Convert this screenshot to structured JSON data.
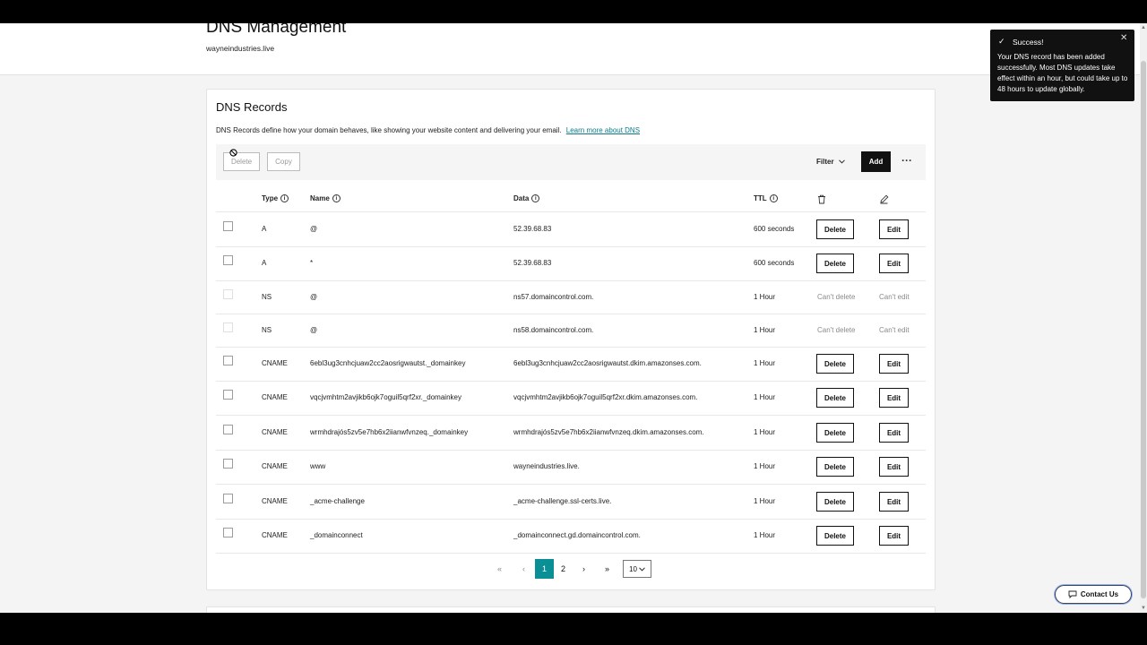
{
  "header": {
    "title": "DNS Management",
    "domain": "wayneindustries.live"
  },
  "records_card": {
    "title": "DNS Records",
    "description": "DNS Records define how your domain behaves, like showing your website content and delivering your email.",
    "learn_more": "Learn more about DNS"
  },
  "toolbar": {
    "delete_label": "Delete",
    "copy_label": "Copy",
    "filter_label": "Filter",
    "add_label": "Add",
    "more_label": "···"
  },
  "columns": {
    "type": "Type",
    "name": "Name",
    "data": "Data",
    "ttl": "TTL"
  },
  "rows": [
    {
      "type": "A",
      "name": "@",
      "data": "52.39.68.83",
      "ttl": "600 seconds",
      "delete": "Delete",
      "edit": "Edit"
    },
    {
      "type": "A",
      "name": "*",
      "data": "52.39.68.83",
      "ttl": "600 seconds",
      "delete": "Delete",
      "edit": "Edit"
    },
    {
      "type": "NS",
      "name": "@",
      "data": "ns57.domaincontrol.com.",
      "ttl": "1 Hour",
      "delete": "Can't delete",
      "edit": "Can't edit"
    },
    {
      "type": "NS",
      "name": "@",
      "data": "ns58.domaincontrol.com.",
      "ttl": "1 Hour",
      "delete": "Can't delete",
      "edit": "Can't edit"
    },
    {
      "type": "CNAME",
      "name": "6ebl3ug3cnhcjuaw2cc2aosrigwautst._domainkey",
      "data": "6ebl3ug3cnhcjuaw2cc2aosrigwautst.dkim.amazonses.com.",
      "ttl": "1 Hour",
      "delete": "Delete",
      "edit": "Edit"
    },
    {
      "type": "CNAME",
      "name": "vqcjvmhtm2avjikb6ojk7oguil5qrf2xr._domainkey",
      "data": "vqcjvmhtm2avjikb6ojk7oguil5qrf2xr.dkim.amazonses.com.",
      "ttl": "1 Hour",
      "delete": "Delete",
      "edit": "Edit"
    },
    {
      "type": "CNAME",
      "name": "wrmhdrajós5zv5e7hb6x2iianwfvnzeq._domainkey",
      "data": "wrmhdrajós5zv5e7hb6x2iianwfvnzeq.dkim.amazonses.com.",
      "ttl": "1 Hour",
      "delete": "Delete",
      "edit": "Edit"
    },
    {
      "type": "CNAME",
      "name": "www",
      "data": "wayneindustries.live.",
      "ttl": "1 Hour",
      "delete": "Delete",
      "edit": "Edit"
    },
    {
      "type": "CNAME",
      "name": "_acme-challenge",
      "data": "_acme-challenge.ssl-certs.live.",
      "ttl": "1 Hour",
      "delete": "Delete",
      "edit": "Edit"
    },
    {
      "type": "CNAME",
      "name": "_domainconnect",
      "data": "_domainconnect.gd.domaincontrol.com.",
      "ttl": "1 Hour",
      "delete": "Delete",
      "edit": "Edit"
    }
  ],
  "pagination": {
    "first": "«",
    "prev": "‹",
    "page1": "1",
    "page2": "2",
    "next": "›",
    "last": "»",
    "per_page": "10",
    "current_page": 1
  },
  "toast": {
    "title": "Success!",
    "message": "Your DNS record has been added successfully. Most DNS updates take effect within an hour, but could take up to 48 hours to update globally."
  },
  "contact": {
    "label": "Contact Us"
  },
  "colors": {
    "accent": "#0b8f97",
    "link": "#0b7a88",
    "primary_button": "#111111"
  }
}
